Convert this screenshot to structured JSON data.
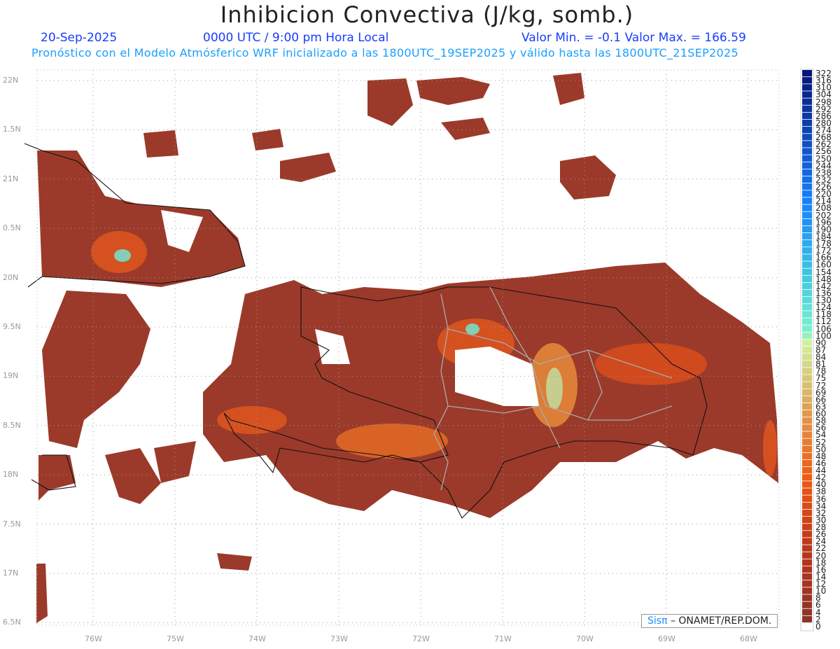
{
  "header": {
    "title": "Inhibicion Convectiva (J/kg, somb.)",
    "date": "20-Sep-2025",
    "time": "0000 UTC / 9:00 pm Hora Local",
    "minmax": "Valor Min. = -0.1  Valor Max. = 166.59",
    "subtitle": "Pronóstico con el Modelo Atmósferico WRF inicializado a las 1800UTC_19SEP2025 y válido hasta las  1800UTC_21SEP2025"
  },
  "axes": {
    "y_labels": [
      "22N",
      "1.5N",
      "21N",
      "0.5N",
      "20N",
      "9.5N",
      "19N",
      "8.5N",
      "18N",
      "7.5N",
      "17N",
      "6.5N"
    ],
    "x_labels": [
      "76W",
      "75W",
      "74W",
      "73W",
      "72W",
      "71W",
      "70W",
      "69W",
      "68W"
    ]
  },
  "colorbar": {
    "labels": [
      "322",
      "316",
      "310",
      "304",
      "298",
      "292",
      "286",
      "280",
      "274",
      "268",
      "262",
      "256",
      "250",
      "244",
      "238",
      "232",
      "226",
      "220",
      "214",
      "208",
      "202",
      "196",
      "190",
      "184",
      "178",
      "172",
      "166",
      "160",
      "154",
      "148",
      "142",
      "136",
      "130",
      "124",
      "118",
      "112",
      "106",
      "100",
      "90",
      "87",
      "84",
      "81",
      "78",
      "75",
      "72",
      "69",
      "66",
      "63",
      "60",
      "58",
      "56",
      "54",
      "52",
      "50",
      "48",
      "46",
      "44",
      "42",
      "40",
      "38",
      "36",
      "34",
      "32",
      "30",
      "28",
      "26",
      "24",
      "22",
      "20",
      "18",
      "16",
      "14",
      "12",
      "10",
      "8",
      "6",
      "4",
      "2",
      "0"
    ]
  },
  "credit": {
    "brand": "Sisπ",
    "text": " – ONAMET/REP.DOM."
  },
  "colors": {
    "land": "#9b3a2a",
    "orange": "#e0561e",
    "header_blue": "#1a3cff",
    "subtitle_blue": "#1aa0ff"
  }
}
